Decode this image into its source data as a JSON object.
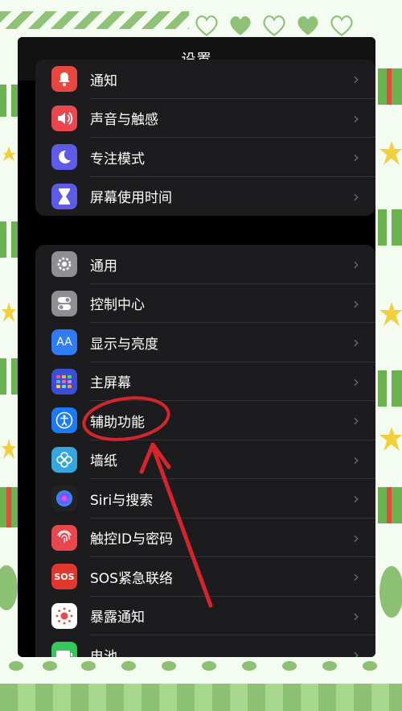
{
  "nav": {
    "title": "设置"
  },
  "colors": {
    "accent_red": "#d3252b",
    "bg": "#000000",
    "cell": "#1c1c1e"
  },
  "group1": [
    {
      "label": "通知",
      "icon": "bell-icon",
      "color": "#e8473f"
    },
    {
      "label": "声音与触感",
      "icon": "speaker-icon",
      "color": "#e8474d"
    },
    {
      "label": "专注模式",
      "icon": "moon-icon",
      "color": "#5e5ce6"
    },
    {
      "label": "屏幕使用时间",
      "icon": "hourglass-icon",
      "color": "#5e5ce6"
    }
  ],
  "group2": [
    {
      "label": "通用",
      "icon": "gear-icon",
      "color": "#8e8e93"
    },
    {
      "label": "控制中心",
      "icon": "toggle-icon",
      "color": "#8e8e93"
    },
    {
      "label": "显示与亮度",
      "icon": "text-size-icon",
      "color": "#2f7cf6",
      "glyph": "AA"
    },
    {
      "label": "主屏幕",
      "icon": "grid-icon",
      "color": "#3a4fd6"
    },
    {
      "label": "辅助功能",
      "icon": "accessibility-icon",
      "color": "#1d7af6"
    },
    {
      "label": "墙纸",
      "icon": "flower-icon",
      "color": "#36a6de"
    },
    {
      "label": "Siri与搜索",
      "icon": "siri-icon",
      "color": "#222222"
    },
    {
      "label": "触控ID与密码",
      "icon": "fingerprint-icon",
      "color": "#e8474d"
    },
    {
      "label": "SOS紧急联络",
      "icon": "sos-icon",
      "color": "#e0382f",
      "glyph": "SOS"
    },
    {
      "label": "暴露通知",
      "icon": "exposure-icon",
      "color": "#ffffff"
    },
    {
      "label": "电池",
      "icon": "battery-icon",
      "color": "#34c759"
    }
  ],
  "chevron": "›"
}
